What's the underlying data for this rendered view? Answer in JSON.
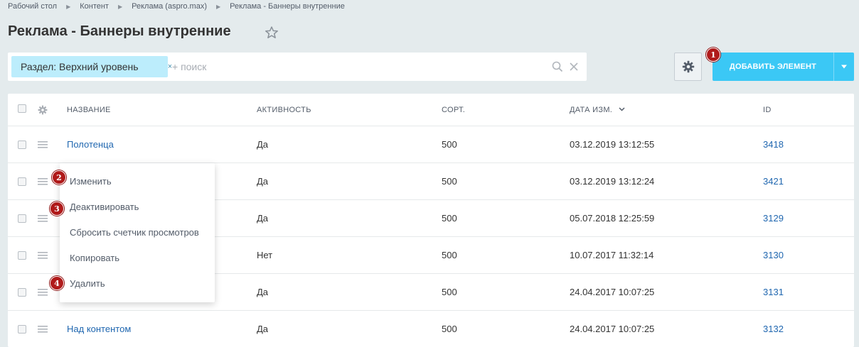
{
  "breadcrumbs": [
    "Рабочий стол",
    "Контент",
    "Реклама (aspro.max)",
    "Реклама - Баннеры внутренние"
  ],
  "page_title": "Реклама - Баннеры внутренние",
  "filter": {
    "chip_label": "Раздел: Верхний уровень",
    "chip_close": "×",
    "search_placeholder": "+ поиск"
  },
  "toolbar": {
    "add_label": "Добавить элемент"
  },
  "badges": [
    "1",
    "2",
    "3",
    "4"
  ],
  "grid": {
    "columns": [
      "Название",
      "Активность",
      "Сорт.",
      "Дата изм.",
      "ID"
    ],
    "rows": [
      {
        "name": "Полотенца",
        "active": "Да",
        "sort": "500",
        "date": "03.12.2019 13:12:55",
        "id": "3418"
      },
      {
        "name": "",
        "active": "Да",
        "sort": "500",
        "date": "03.12.2019 13:12:24",
        "id": "3421"
      },
      {
        "name": "",
        "active": "Да",
        "sort": "500",
        "date": "05.07.2018 12:25:59",
        "id": "3129"
      },
      {
        "name": "",
        "active": "Нет",
        "sort": "500",
        "date": "10.07.2017 11:32:14",
        "id": "3130"
      },
      {
        "name": "",
        "active": "Да",
        "sort": "500",
        "date": "24.04.2017 10:07:25",
        "id": "3131"
      },
      {
        "name": "Над контентом",
        "active": "Да",
        "sort": "500",
        "date": "24.04.2017 10:07:25",
        "id": "3132"
      }
    ]
  },
  "context_menu": {
    "items": [
      "Изменить",
      "Деактивировать",
      "Сбросить счетчик просмотров",
      "Копировать",
      "Удалить"
    ]
  },
  "colors": {
    "accent": "#3bc8f5",
    "chip": "#bcedfc",
    "link": "#2067b0",
    "badge": "#b01a1a",
    "background": "#e4ebed"
  }
}
